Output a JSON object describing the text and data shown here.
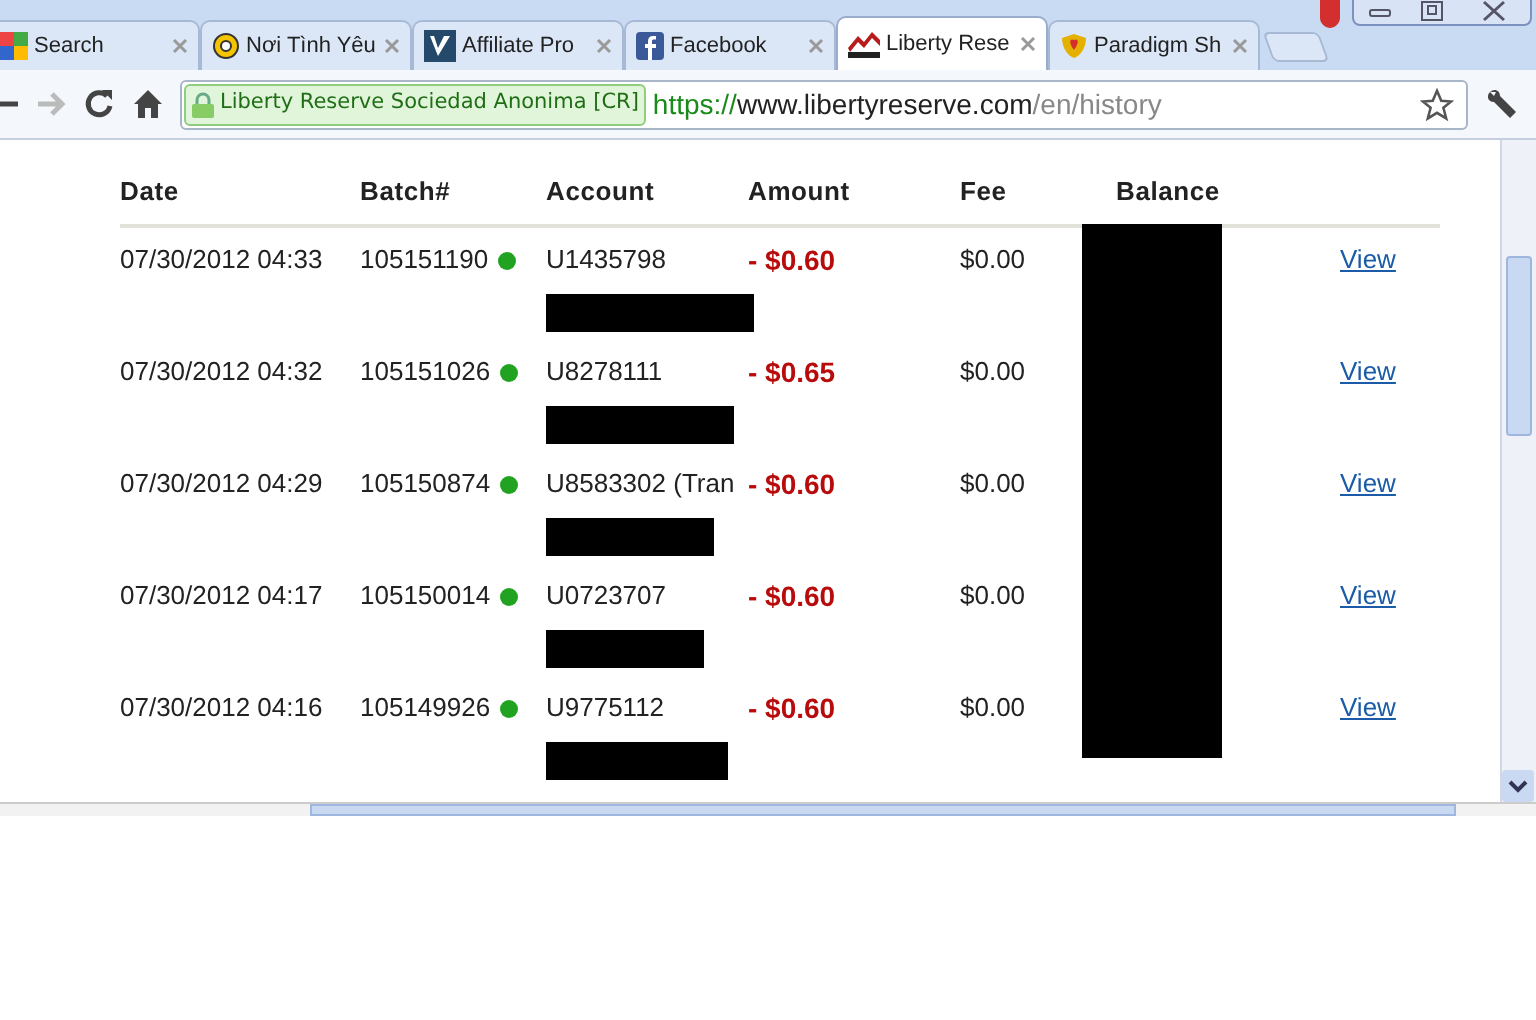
{
  "tabs": [
    {
      "title": "Search",
      "selected": false
    },
    {
      "title": "Nơi Tình Yêu",
      "selected": false
    },
    {
      "title": "Affiliate Pro",
      "selected": false
    },
    {
      "title": "Facebook",
      "selected": false
    },
    {
      "title": "Liberty Rese",
      "selected": true
    },
    {
      "title": "Paradigm Sh",
      "selected": false
    }
  ],
  "address_bar": {
    "identity": "Liberty Reserve Sociedad Anonima [CR]",
    "scheme": "https://",
    "host": "www.libertyreserve.com",
    "path": "/en/history"
  },
  "table": {
    "columns": [
      "Date",
      "Batch#",
      "Account",
      "Amount",
      "Fee",
      "Balance"
    ],
    "rows": [
      {
        "date": "07/30/2012 04:33",
        "batch": "105151190",
        "account": "U1435798",
        "amount": "- $0.60",
        "fee": "$0.00",
        "link": "View"
      },
      {
        "date": "07/30/2012 04:32",
        "batch": "105151026",
        "account": "U8278111",
        "amount": "- $0.65",
        "fee": "$0.00",
        "link": "View"
      },
      {
        "date": "07/30/2012 04:29",
        "batch": "105150874",
        "account": "U8583302 (Tran",
        "amount": "- $0.60",
        "fee": "$0.00",
        "link": "View"
      },
      {
        "date": "07/30/2012 04:17",
        "batch": "105150014",
        "account": "U0723707",
        "amount": "- $0.60",
        "fee": "$0.00",
        "link": "View"
      },
      {
        "date": "07/30/2012 04:16",
        "batch": "105149926",
        "account": "U9775112",
        "amount": "- $0.60",
        "fee": "$0.00",
        "link": "View"
      }
    ]
  }
}
